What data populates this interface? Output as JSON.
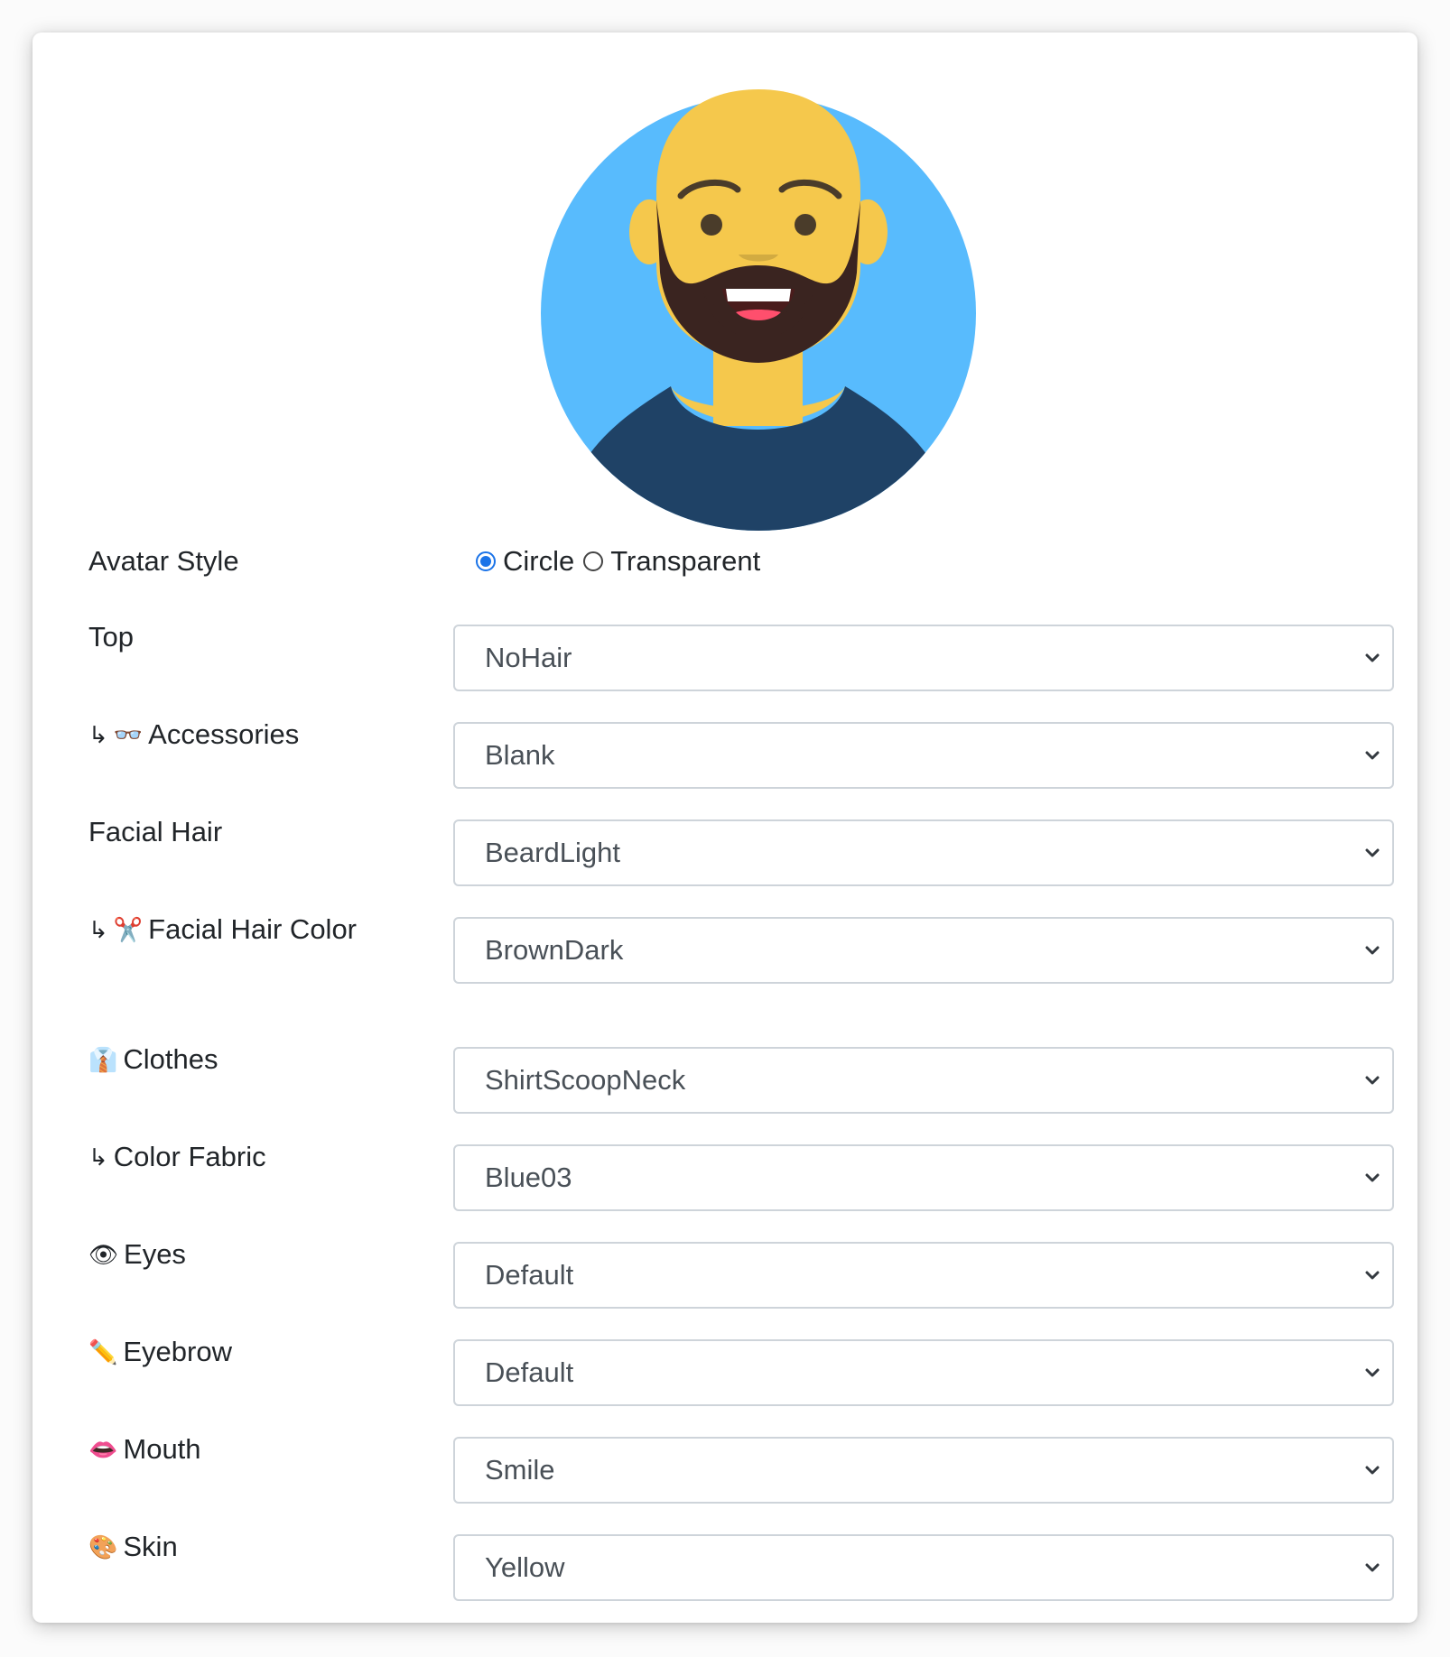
{
  "avatar": {
    "colors": {
      "background": "#58BBFD",
      "skin": "#F5C84C",
      "facial_hair": "#3A2420",
      "clothes": "#1F4266",
      "eyes": "#4A3C2A",
      "mouth": "#FF4F6D"
    }
  },
  "form": {
    "avatar_style": {
      "label": "Avatar Style",
      "options": [
        "Circle",
        "Transparent"
      ],
      "selected": "Circle"
    },
    "rows": [
      {
        "label": "Top",
        "prefix": "",
        "icon": "",
        "value": "NoHair"
      },
      {
        "label": "Accessories",
        "prefix": "↳",
        "icon": "👓",
        "value": "Blank"
      },
      {
        "label": "Facial Hair",
        "prefix": "",
        "icon": "",
        "value": "BeardLight"
      },
      {
        "label": "Facial Hair Color",
        "prefix": "↳",
        "icon": "✂️",
        "value": "BrownDark"
      },
      {
        "label": "Clothes",
        "prefix": "",
        "icon": "👔",
        "value": "ShirtScoopNeck"
      },
      {
        "label": "Color Fabric",
        "prefix": "↳",
        "icon": "",
        "value": "Blue03"
      },
      {
        "label": "Eyes",
        "prefix": "",
        "icon": "👁",
        "value": "Default"
      },
      {
        "label": "Eyebrow",
        "prefix": "",
        "icon": "✏️",
        "value": "Default"
      },
      {
        "label": "Mouth",
        "prefix": "",
        "icon": "👄",
        "value": "Smile"
      },
      {
        "label": "Skin",
        "prefix": "",
        "icon": "🎨",
        "value": "Yellow"
      }
    ]
  }
}
